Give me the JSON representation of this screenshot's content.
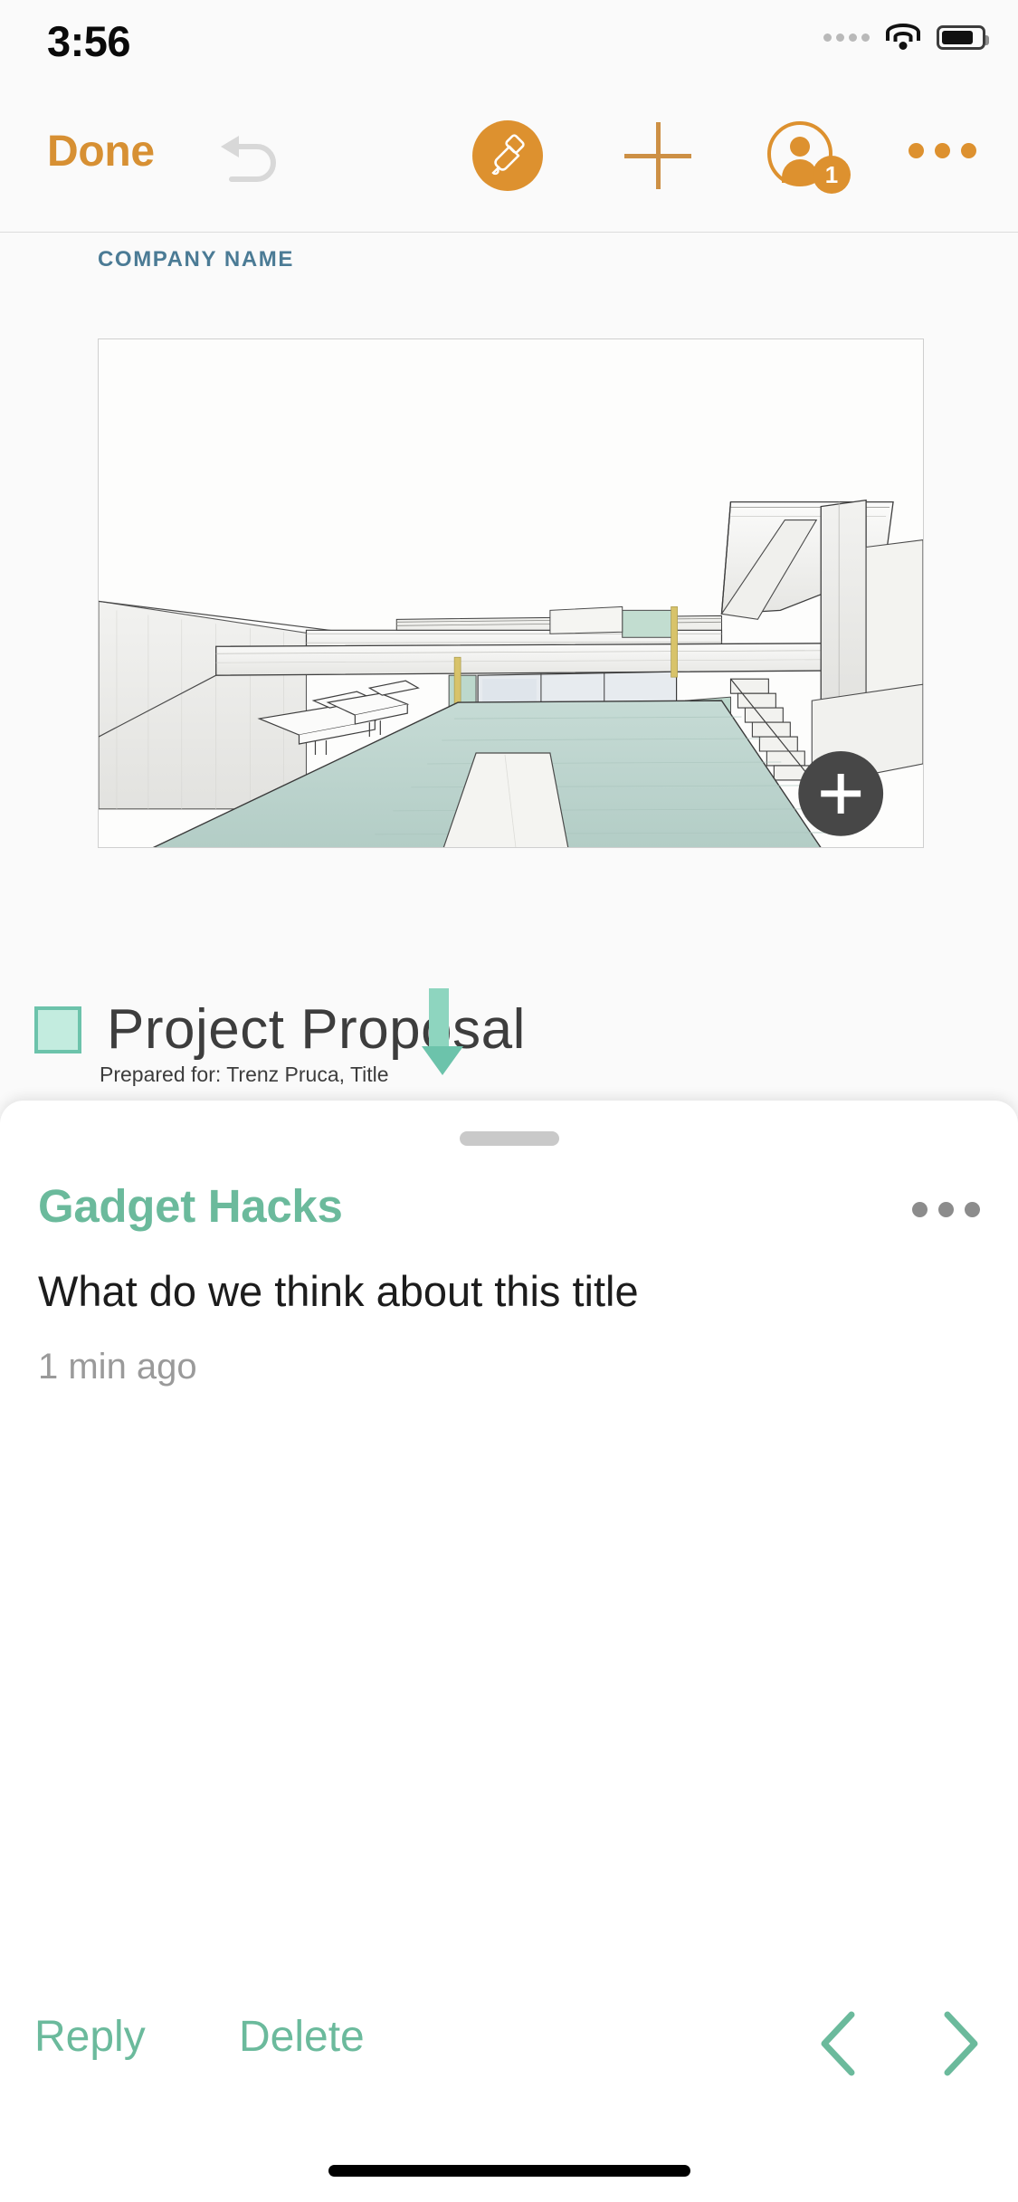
{
  "statusbar": {
    "time": "3:56",
    "signal_icon": "signal-dots-icon",
    "wifi_icon": "wifi-icon",
    "battery_icon": "battery-icon"
  },
  "toolbar": {
    "done_label": "Done",
    "undo_icon": "undo-arrow-icon",
    "format_icon": "paintbrush-icon",
    "insert_icon": "plus-icon",
    "collaborate_icon": "person-icon",
    "collaborator_count": "1",
    "more_icon": "ellipsis-icon",
    "accent_color": "#dd912f",
    "undo_disabled_color": "#d8d8d8"
  },
  "slide": {
    "company_name": "COMPANY NAME",
    "title": "Project Proposal",
    "subtitle": "Prepared for: Trenz Pruca, Title",
    "bullet_fill_color": "#c3ecdf",
    "bullet_border_color": "#6cc3ab",
    "cursor_color": "#8ed5bf",
    "company_name_color": "#4b7b95",
    "image_alt": "architectural-sketch-of-modern-house-with-pool",
    "add_media_icon": "plus-icon",
    "add_media_bg": "#474747",
    "pool_color": "#bcd3ce"
  },
  "comment_sheet": {
    "drag_handle": "sheet-drag-handle",
    "author": "Gadget Hacks",
    "author_color": "#6bba9c",
    "text": "What do we think about this title",
    "timestamp": "1 min ago",
    "menu_icon": "ellipsis-icon"
  },
  "action_bar": {
    "reply_label": "Reply",
    "delete_label": "Delete",
    "prev_icon": "chevron-left-icon",
    "next_icon": "chevron-right-icon",
    "accent_color": "#6bba9c"
  },
  "home_indicator": "home-indicator-bar"
}
